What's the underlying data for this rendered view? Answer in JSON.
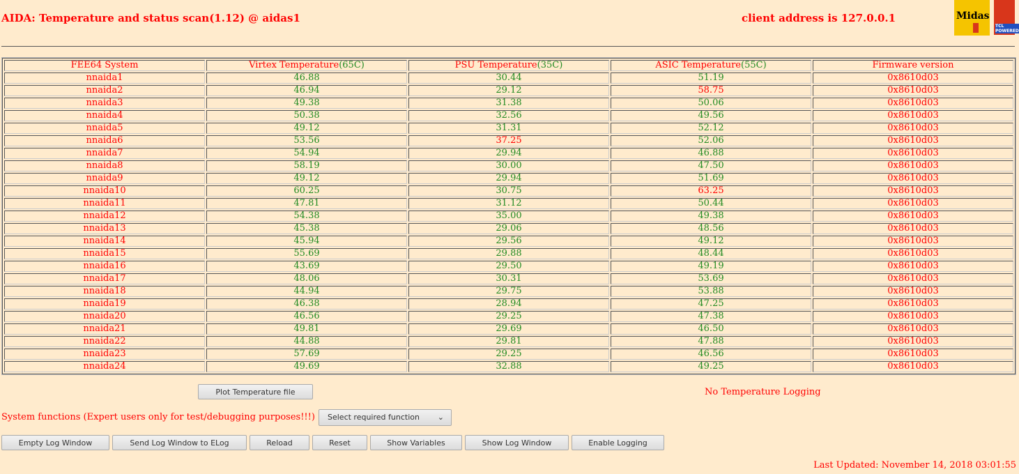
{
  "header": {
    "title": "AIDA: Temperature and status scan(1.12) @ aidas1",
    "client_address": "client address is 127.0.0.1",
    "logos": [
      "Midas",
      "TCL POWERED"
    ]
  },
  "colors": {
    "background": "#ffebcd",
    "alarm": "#ff0000",
    "ok": "#228b22"
  },
  "table": {
    "headers": [
      {
        "label": "FEE64 System",
        "limit": ""
      },
      {
        "label": "Virtex Temperature",
        "limit": "(65C)"
      },
      {
        "label": "PSU Temperature",
        "limit": "(35C)"
      },
      {
        "label": "ASIC Temperature",
        "limit": "(55C)"
      },
      {
        "label": "Firmware version",
        "limit": ""
      }
    ],
    "rows": [
      {
        "name": "nnaida1",
        "virtex": "46.88",
        "psu": "30.44",
        "asic": "51.19",
        "fw": "0x8610d03"
      },
      {
        "name": "nnaida2",
        "virtex": "46.94",
        "psu": "29.12",
        "asic": "58.75",
        "fw": "0x8610d03",
        "asic_alarm": true
      },
      {
        "name": "nnaida3",
        "virtex": "49.38",
        "psu": "31.38",
        "asic": "50.06",
        "fw": "0x8610d03"
      },
      {
        "name": "nnaida4",
        "virtex": "50.38",
        "psu": "32.56",
        "asic": "49.56",
        "fw": "0x8610d03"
      },
      {
        "name": "nnaida5",
        "virtex": "49.12",
        "psu": "31.31",
        "asic": "52.12",
        "fw": "0x8610d03"
      },
      {
        "name": "nnaida6",
        "virtex": "53.56",
        "psu": "37.25",
        "asic": "52.06",
        "fw": "0x8610d03",
        "psu_alarm": true
      },
      {
        "name": "nnaida7",
        "virtex": "54.94",
        "psu": "29.94",
        "asic": "46.88",
        "fw": "0x8610d03"
      },
      {
        "name": "nnaida8",
        "virtex": "58.19",
        "psu": "30.00",
        "asic": "47.50",
        "fw": "0x8610d03"
      },
      {
        "name": "nnaida9",
        "virtex": "49.12",
        "psu": "29.94",
        "asic": "51.69",
        "fw": "0x8610d03"
      },
      {
        "name": "nnaida10",
        "virtex": "60.25",
        "psu": "30.75",
        "asic": "63.25",
        "fw": "0x8610d03",
        "asic_alarm": true
      },
      {
        "name": "nnaida11",
        "virtex": "47.81",
        "psu": "31.12",
        "asic": "50.44",
        "fw": "0x8610d03"
      },
      {
        "name": "nnaida12",
        "virtex": "54.38",
        "psu": "35.00",
        "asic": "49.38",
        "fw": "0x8610d03"
      },
      {
        "name": "nnaida13",
        "virtex": "45.38",
        "psu": "29.06",
        "asic": "48.56",
        "fw": "0x8610d03"
      },
      {
        "name": "nnaida14",
        "virtex": "45.94",
        "psu": "29.56",
        "asic": "49.12",
        "fw": "0x8610d03"
      },
      {
        "name": "nnaida15",
        "virtex": "55.69",
        "psu": "29.88",
        "asic": "48.44",
        "fw": "0x8610d03"
      },
      {
        "name": "nnaida16",
        "virtex": "43.69",
        "psu": "29.50",
        "asic": "49.19",
        "fw": "0x8610d03"
      },
      {
        "name": "nnaida17",
        "virtex": "48.06",
        "psu": "30.31",
        "asic": "53.69",
        "fw": "0x8610d03"
      },
      {
        "name": "nnaida18",
        "virtex": "44.94",
        "psu": "29.75",
        "asic": "53.88",
        "fw": "0x8610d03"
      },
      {
        "name": "nnaida19",
        "virtex": "46.38",
        "psu": "28.94",
        "asic": "47.25",
        "fw": "0x8610d03"
      },
      {
        "name": "nnaida20",
        "virtex": "46.56",
        "psu": "29.25",
        "asic": "47.38",
        "fw": "0x8610d03"
      },
      {
        "name": "nnaida21",
        "virtex": "49.81",
        "psu": "29.69",
        "asic": "46.50",
        "fw": "0x8610d03"
      },
      {
        "name": "nnaida22",
        "virtex": "44.88",
        "psu": "29.81",
        "asic": "47.88",
        "fw": "0x8610d03"
      },
      {
        "name": "nnaida23",
        "virtex": "57.69",
        "psu": "29.25",
        "asic": "46.56",
        "fw": "0x8610d03"
      },
      {
        "name": "nnaida24",
        "virtex": "49.69",
        "psu": "32.88",
        "asic": "49.25",
        "fw": "0x8610d03"
      }
    ]
  },
  "controls": {
    "plot_button": "Plot Temperature file",
    "logging_status": "No Temperature Logging",
    "system_functions_label": "System functions (Expert users only for test/debugging purposes!!!)",
    "function_select": "Select required function",
    "buttons": [
      "Empty Log Window",
      "Send Log Window to ELog",
      "Reload",
      "Reset",
      "Show Variables",
      "Show Log Window",
      "Enable Logging"
    ]
  },
  "footer": {
    "last_updated": "Last Updated: November 14, 2018 03:01:55"
  }
}
